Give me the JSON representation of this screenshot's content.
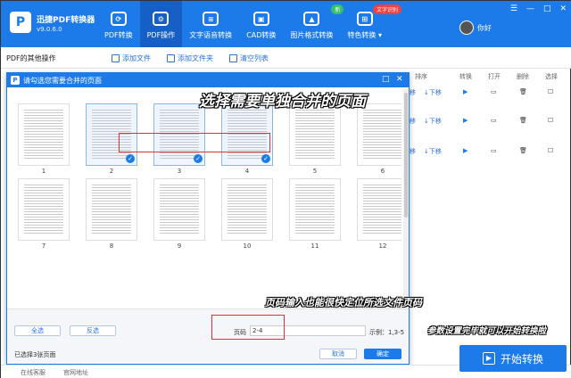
{
  "app": {
    "logo": "P",
    "title": "迅捷PDF转换器",
    "version": "v9.0.6.0",
    "username": "你好"
  },
  "nav": [
    {
      "label": "PDF转换",
      "icon": "refresh-icon",
      "glyph": "⟳"
    },
    {
      "label": "PDF操作",
      "icon": "gear-icon",
      "glyph": "⚙"
    },
    {
      "label": "文字语音转换",
      "icon": "audio-icon",
      "glyph": "≋"
    },
    {
      "label": "CAD转换",
      "icon": "cad-icon",
      "glyph": "▣"
    },
    {
      "label": "图片格式转换",
      "icon": "image-icon",
      "glyph": "▲"
    },
    {
      "label": "特色转换 ▾",
      "icon": "hierarchy-icon",
      "glyph": "⊞"
    }
  ],
  "badges": {
    "new": "新",
    "ocr": "文字识别"
  },
  "window_controls": {
    "menu": "☰",
    "minimize": "—",
    "maximize": "□",
    "close": "✕"
  },
  "toolbar": {
    "section_title": "PDF的其他操作",
    "add_file": "添加文件",
    "add_folder": "添加文件夹",
    "clear_list": "清空列表"
  },
  "list": {
    "headers": [
      "排序",
      "转换",
      "打开",
      "删除",
      "选择"
    ],
    "down_label": "↓下移",
    "prefix": "移",
    "play": "▶",
    "open": "▭",
    "delete": "🗑",
    "check": "☐"
  },
  "dialog": {
    "logo": "P",
    "title": "请勾选您需要合并的页面",
    "ctrl_max": "□",
    "ctrl_close": "✕",
    "check_mark": "✓",
    "pages": [
      "1",
      "2",
      "3",
      "4",
      "5",
      "6",
      "7",
      "8",
      "9",
      "10",
      "11",
      "12"
    ],
    "selected_pages": [
      2,
      3,
      4
    ],
    "select_all": "全选",
    "invert": "反选",
    "page_label": "页码",
    "page_value": "2-4",
    "example": "示例：1,3-5",
    "selected_text": "已选择3张页面",
    "cancel": "取消",
    "confirm": "确定"
  },
  "callouts": {
    "select_pages": "选择需要单独合并的页面",
    "page_input_tip": "页码输入也能很快定位所选文件页码",
    "start_tip": "参数设置完毕就可以开始转换啦"
  },
  "bottom": {
    "online_service": "在线客服",
    "website": "官网地址"
  },
  "start_button": {
    "label": "开始转换"
  },
  "colors": {
    "brand": "#1c7be9",
    "highlight": "#e53030"
  }
}
